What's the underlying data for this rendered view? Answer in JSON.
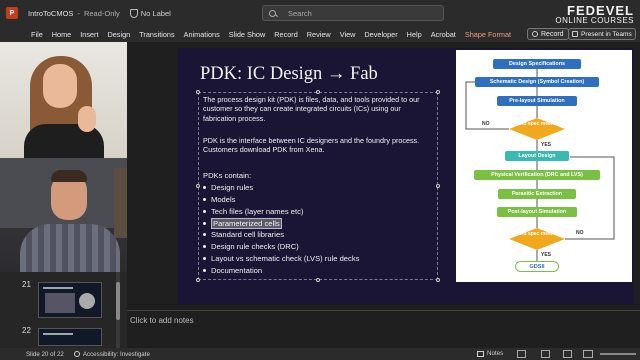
{
  "titlebar": {
    "app_icon": "P",
    "file_name": "IntroToCMOS",
    "separator": "-",
    "mode": "Read-Only",
    "sensitivity_label": "No Label",
    "search_placeholder": "Search",
    "brand_line1": "FEDEVEL",
    "brand_line2": "ONLINE COURSES"
  },
  "ribbon": {
    "tabs": [
      "File",
      "Home",
      "Insert",
      "Design",
      "Transitions",
      "Animations",
      "Slide Show",
      "Record",
      "Review",
      "View",
      "Developer",
      "Help",
      "Acrobat"
    ],
    "accent_tab": "Shape Format",
    "record_label": "Record",
    "present_label": "Present in Teams"
  },
  "thumbnails": [
    {
      "number": "21"
    },
    {
      "number": "22"
    }
  ],
  "slide": {
    "title": "PDK: IC Design → Fab",
    "paragraph1": "The process design kit (PDK) is files, data, and tools provided to our customer so they can create integrated circuits (ICs) using our fabrication process.",
    "paragraph2": "PDK is the interface between IC designers and the foundry process. Customers download PDK from Xena.",
    "list_heading": "PDKs contain:",
    "bullets": [
      "Design rules",
      "Models",
      "Tech files (layer names etc)",
      "Parameterized cells",
      "Standard cell libraries",
      "Design rule checks (DRC)",
      "Layout vs schematic check (LVS) rule decks",
      "Documentation"
    ],
    "selected_bullet_index": 3
  },
  "flowchart": {
    "steps": [
      "Design Specifications",
      "Schematic Design (Symbol Creation)",
      "Pre-layout Simulation",
      "Layout Design",
      "Physical Verification (DRC and LVS)",
      "Parasitic Extraction",
      "Post-layout Simulation"
    ],
    "decision1": "Did spec meet?",
    "decision2": "Did spec meet?",
    "yes_label": "YES",
    "no_label": "NO",
    "end": "GDSII",
    "colors": {
      "blue": "#2e6fbf",
      "teal": "#39b9b0",
      "green": "#7ac143",
      "orange": "#f2a81d"
    }
  },
  "notes": {
    "placeholder": "Click to add notes"
  },
  "status": {
    "slide_counter": "Slide 20 of 22",
    "accessibility": "Accessibility: Investigate",
    "notes_label": "Notes"
  }
}
